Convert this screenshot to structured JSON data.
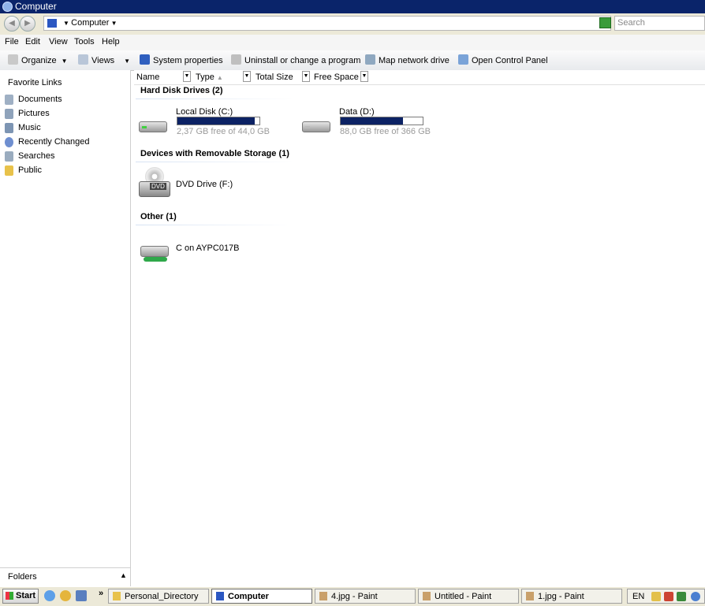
{
  "window": {
    "title": "Computer"
  },
  "address": {
    "location": "Computer",
    "search_placeholder": "Search"
  },
  "menu": [
    "File",
    "Edit",
    "View",
    "Tools",
    "Help"
  ],
  "commands": {
    "organize": "Organize",
    "views": "Views",
    "system_properties": "System properties",
    "uninstall": "Uninstall or change a program",
    "map_drive": "Map network drive",
    "control_panel": "Open Control Panel"
  },
  "sidebar": {
    "header": "Favorite Links",
    "items": [
      {
        "label": "Documents",
        "icon": "documents-icon"
      },
      {
        "label": "Pictures",
        "icon": "pictures-icon"
      },
      {
        "label": "Music",
        "icon": "music-icon"
      },
      {
        "label": "Recently Changed",
        "icon": "recent-icon"
      },
      {
        "label": "Searches",
        "icon": "searches-icon"
      },
      {
        "label": "Public",
        "icon": "public-folder-icon"
      }
    ],
    "folders_label": "Folders"
  },
  "columns": [
    "Name",
    "Type",
    "Total Size",
    "Free Space"
  ],
  "groups": {
    "hard_disks": "Hard Disk Drives (2)",
    "removable": "Devices with Removable Storage (1)",
    "other": "Other (1)"
  },
  "drives": [
    {
      "label": "Local Disk (C:)",
      "free": "2,37 GB free of 44,0 GB",
      "used_fraction": 0.946
    },
    {
      "label": "Data (D:)",
      "free": "88,0 GB free of 366 GB",
      "used_fraction": 0.76
    }
  ],
  "removable": {
    "label": "DVD Drive (F:)",
    "badge": "DVD"
  },
  "other": {
    "label": "C on AYPC017B"
  },
  "taskbar": {
    "start": "Start",
    "overflow": "»",
    "buttons": [
      {
        "label": "Personal_Directory"
      },
      {
        "label": "Computer"
      },
      {
        "label": "4.jpg - Paint"
      },
      {
        "label": "Untitled - Paint"
      },
      {
        "label": "1.jpg - Paint"
      }
    ],
    "language": "EN"
  },
  "colors": {
    "titlebar": "#0a246a",
    "bar_fill": "#0c2264"
  }
}
